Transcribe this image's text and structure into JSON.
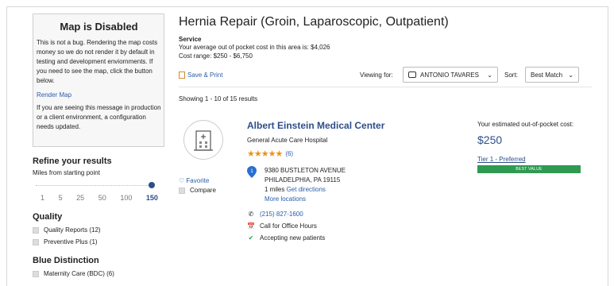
{
  "sidebar": {
    "map_title": "Map is Disabled",
    "map_text": "This is not a bug. Rendering the map costs money so we do not render it by default in testing and development enviornments. If you need to see the map, click the button below.",
    "render_map": "Render Map",
    "map_note": "If you are seeing this message in production or a client environment, a configuration needs updated.",
    "refine_title": "Refine your results",
    "miles_label": "Miles from starting point",
    "miles_options": [
      "1",
      "5",
      "25",
      "50",
      "100",
      "150"
    ],
    "miles_selected": "150",
    "quality_title": "Quality",
    "quality_items": [
      "Quality Reports (12)",
      "Preventive Plus (1)"
    ],
    "blue_title": "Blue Distinction",
    "blue_items": [
      "Maternity Care (BDC) (6)"
    ]
  },
  "main": {
    "title": "Hernia Repair (Groin, Laparoscopic, Outpatient)",
    "service_label": "Service",
    "avg_cost": "Your average out of pocket cost in this area is: $4,026",
    "cost_range": "Cost range: $250 - $6,750",
    "save_print": "Save & Print",
    "viewing_for_label": "Viewing for:",
    "viewing_for_value": "ANTONIO TAVARES",
    "sort_label": "Sort:",
    "sort_value": "Best Match",
    "showing": "Showing 1 - 10 of 15 results"
  },
  "result": {
    "name": "Albert Einstein Medical Center",
    "type": "General Acute Care Hospital",
    "rating": 4.5,
    "stars": "★★★★★",
    "review_count": "(6)",
    "pin_number": "1",
    "address1": "9380 BUSTLETON AVENUE",
    "address2": "PHILADELPHIA, PA 19115",
    "distance": "1 miles",
    "directions": "Get directions",
    "more_locations": "More locations",
    "phone": "(215) 827-1600",
    "office_hours": "Call for Office Hours",
    "accepting": "Accepting new patients",
    "favorite": "Favorite",
    "compare": "Compare",
    "cost_label": "Your estimated out-of-pocket cost:",
    "cost_value": "$250",
    "tier": "Tier 1 - Preferred",
    "badge": "BEST VALUE"
  },
  "colors": {
    "brand_blue": "#2d4e8a",
    "link_blue": "#2a5caa",
    "star_orange": "#e8931c",
    "badge_green": "#2f9a52",
    "check_green": "#2f9a52"
  }
}
